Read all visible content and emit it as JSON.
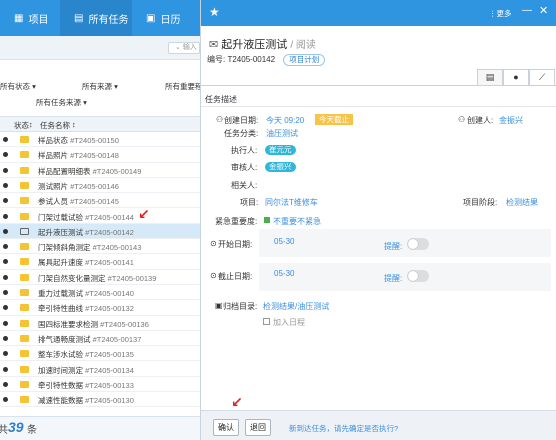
{
  "nav": {
    "items": [
      {
        "label": "项目",
        "icon": "grid-icon"
      },
      {
        "label": "所有任务",
        "icon": "table-icon"
      },
      {
        "label": "日历",
        "icon": "calendar-icon"
      }
    ]
  },
  "search": {
    "placeholder": "输入"
  },
  "filters": {
    "status": "所有状态",
    "source": "所有来源",
    "importance": "所有重要程",
    "task_source": "所有任务来源"
  },
  "table": {
    "headers": {
      "status": "状态",
      "name": "任务名称"
    },
    "rows": [
      {
        "name": "样品状态",
        "code": "#T2405-00150",
        "icon": "envelope-icon",
        "selected": false
      },
      {
        "name": "样品照片",
        "code": "#T2405-00148",
        "icon": "envelope-icon",
        "selected": false
      },
      {
        "name": "样品配置明细表",
        "code": "#T2405-00149",
        "icon": "envelope-icon",
        "selected": false
      },
      {
        "name": "测试照片",
        "code": "#T2405-00146",
        "icon": "envelope-icon",
        "selected": false
      },
      {
        "name": "参试人员",
        "code": "#T2405-00145",
        "icon": "envelope-icon",
        "selected": false
      },
      {
        "name": "门架过载试验",
        "code": "#T2405-00144",
        "icon": "envelope-icon",
        "selected": false
      },
      {
        "name": "起升液压测试",
        "code": "#T2405-00142",
        "icon": "envelope-open-icon",
        "selected": true
      },
      {
        "name": "门架倾斜角测定",
        "code": "#T2405-00143",
        "icon": "envelope-icon",
        "selected": false
      },
      {
        "name": "属具起升速度",
        "code": "#T2405-00141",
        "icon": "envelope-icon",
        "selected": false
      },
      {
        "name": "门架自然变化量测定",
        "code": "#T2405-00139",
        "icon": "envelope-icon",
        "selected": false
      },
      {
        "name": "重力过载测试",
        "code": "#T2405-00140",
        "icon": "envelope-icon",
        "selected": false
      },
      {
        "name": "牵引特性曲线",
        "code": "#T2405-00132",
        "icon": "envelope-icon",
        "selected": false
      },
      {
        "name": "国四标准要求检测",
        "code": "#T2405-00136",
        "icon": "envelope-icon",
        "selected": false
      },
      {
        "name": "排气通畅度测试",
        "code": "#T2405-00137",
        "icon": "envelope-icon",
        "selected": false
      },
      {
        "name": "整车涉水试验",
        "code": "#T2405-00135",
        "icon": "envelope-icon",
        "selected": false
      },
      {
        "name": "加速时间测定",
        "code": "#T2405-00134",
        "icon": "envelope-icon",
        "selected": false
      },
      {
        "name": "牵引特性数据",
        "code": "#T2405-00133",
        "icon": "envelope-icon",
        "selected": false
      },
      {
        "name": "减速性能数据",
        "code": "#T2405-00130",
        "icon": "envelope-icon",
        "selected": false
      }
    ]
  },
  "footer": {
    "prefix": "共",
    "count": "39",
    "suffix": "条"
  },
  "detail": {
    "more": "更多",
    "title": "起升液压测试",
    "mode": "/ 阅读",
    "code_label": "编号:",
    "code": "T2405-00142",
    "plan": "项目计划",
    "tabs": [
      "list-icon",
      "chat-icon",
      "chart-icon"
    ],
    "section": "任务描述",
    "created_label": "创建日期:",
    "created": "今天 09:20",
    "today_badge": "今天截止",
    "creator_label": "创建人:",
    "creator": "金振兴",
    "category_label": "任务分类:",
    "category": "油压测试",
    "executor_label": "执行人:",
    "executor": "崔元元",
    "reviewer_label": "审核人:",
    "reviewer": "金振兴",
    "related_label": "相关人:",
    "project_label": "项目:",
    "project": "同尔法T维修车",
    "phase_label": "项目阶段:",
    "phase": "检测结果",
    "urgency_label": "紧急重要度:",
    "urgency": "不重要不紧急",
    "start_label": "开始日期:",
    "start": "05-30",
    "end_label": "截止日期:",
    "end": "05-30",
    "remind_label": "提醒:",
    "archive_label": "归档目录:",
    "archive": "检测结果/油压测试",
    "calendar": "加入日程"
  },
  "actions": {
    "confirm": "确认",
    "back": "退回",
    "hint": "新到达任务，请先确定是否执行?"
  },
  "colors": {
    "primary": "#2f95e0",
    "selected_row": "#d5e9f9",
    "badge": "#2fb6d8",
    "warning": "#f7c44a"
  }
}
